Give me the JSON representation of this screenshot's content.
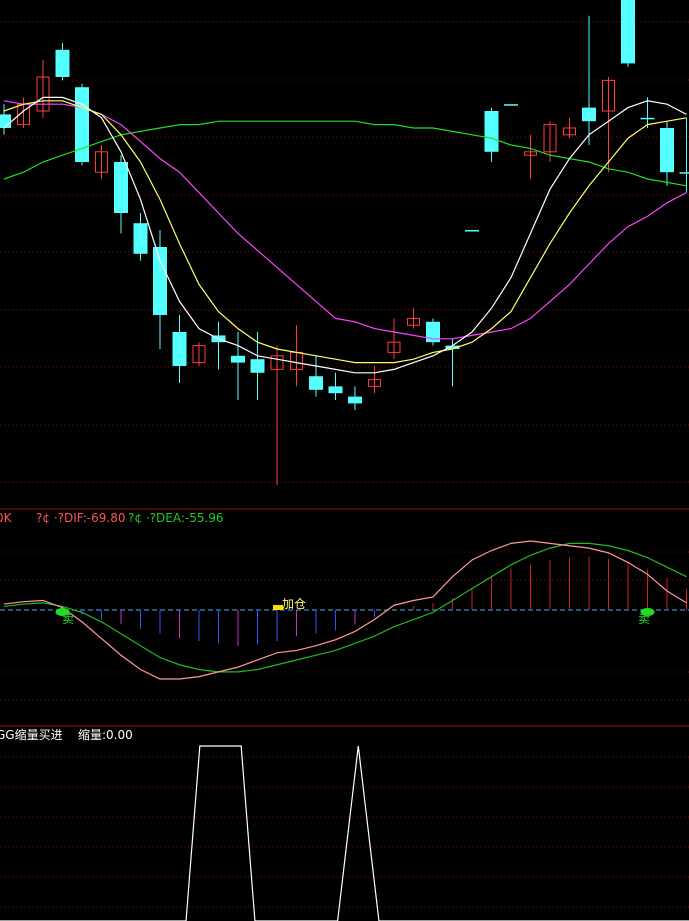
{
  "colors": {
    "background": "#000000",
    "grid": "#8b0000",
    "separator": "#a01010",
    "up_candle": "#ff3b3b",
    "down_candle": "#54ffff",
    "ma_white": "#ffffff",
    "ma_yellow": "#ffff66",
    "ma_magenta": "#ff44ff",
    "ma_green": "#22dd22",
    "dif": "#ff9999",
    "dea": "#22bb22",
    "bar_pos": "#cc2222",
    "bar_neg_blue": "#3355ff",
    "bar_neg_magenta": "#cc33cc",
    "signal_buy": "#22dd22",
    "signal_add": "#ffdd00",
    "dif_label": "#ff5555",
    "dea_label": "#22cc22",
    "suo_line": "#ffffff"
  },
  "macd_panel": {
    "prefix": "0K",
    "dif_label": "?¢ ·?DIF:-69.80",
    "dea_label": "?¢ ·?DEA:-55.96",
    "add_signal": "加仓",
    "sell_signal": "卖"
  },
  "volume_panel": {
    "title": "GG缩量买进",
    "value_label": "缩量:0.00"
  },
  "chart_data": [
    {
      "type": "candlestick",
      "title": "",
      "grid": true,
      "legend": "none",
      "ylim": [
        0,
        100
      ],
      "candles": [
        {
          "o": 59,
          "c": 55,
          "h": 62,
          "l": 53,
          "dir": "down"
        },
        {
          "o": 56,
          "c": 62,
          "h": 64,
          "l": 55,
          "dir": "up"
        },
        {
          "o": 60,
          "c": 70,
          "h": 75,
          "l": 58,
          "dir": "up"
        },
        {
          "o": 70,
          "c": 78,
          "h": 80,
          "l": 69,
          "dir": "down"
        },
        {
          "o": 67,
          "c": 45,
          "h": 68,
          "l": 44,
          "dir": "down"
        },
        {
          "o": 42,
          "c": 48,
          "h": 50,
          "l": 40,
          "dir": "up"
        },
        {
          "o": 45,
          "c": 30,
          "h": 47,
          "l": 24,
          "dir": "down"
        },
        {
          "o": 27,
          "c": 18,
          "h": 30,
          "l": 16,
          "dir": "down"
        },
        {
          "o": 20,
          "c": 0,
          "h": 25,
          "l": -10,
          "dir": "down"
        },
        {
          "o": -5,
          "c": -15,
          "h": 0,
          "l": -20,
          "dir": "down"
        },
        {
          "o": -14,
          "c": -9,
          "h": -8,
          "l": -15,
          "dir": "up"
        },
        {
          "o": -6,
          "c": -8,
          "h": -2,
          "l": -16,
          "dir": "down"
        },
        {
          "o": -12,
          "c": -14,
          "h": -5,
          "l": -25,
          "dir": "down"
        },
        {
          "o": -13,
          "c": -17,
          "h": -5,
          "l": -25,
          "dir": "down"
        },
        {
          "o": -16,
          "c": -12,
          "h": -9,
          "l": -50,
          "dir": "up"
        },
        {
          "o": -16,
          "c": -11,
          "h": -3,
          "l": -21,
          "dir": "up"
        },
        {
          "o": -18,
          "c": -22,
          "h": -12,
          "l": -24,
          "dir": "down"
        },
        {
          "o": -21,
          "c": -23,
          "h": -17,
          "l": -25,
          "dir": "down"
        },
        {
          "o": -24,
          "c": -26,
          "h": -21,
          "l": -28,
          "dir": "down"
        },
        {
          "o": -21,
          "c": -19,
          "h": -15,
          "l": -23,
          "dir": "up"
        },
        {
          "o": -11,
          "c": -8,
          "h": -1,
          "l": -13,
          "dir": "up"
        },
        {
          "o": -3,
          "c": -1,
          "h": 2,
          "l": -4,
          "dir": "up"
        },
        {
          "o": -2,
          "c": -8,
          "h": -1,
          "l": -9,
          "dir": "down"
        },
        {
          "o": -9,
          "c": -10,
          "h": -7,
          "l": -21,
          "dir": "down"
        },
        {
          "o": 25,
          "c": 25,
          "h": 25,
          "l": 25,
          "dir": "down"
        },
        {
          "o": 60,
          "c": 48,
          "h": 61,
          "l": 45,
          "dir": "down"
        },
        {
          "o": 62,
          "c": 62,
          "h": 62,
          "l": 62,
          "dir": "down"
        },
        {
          "o": 47,
          "c": 48,
          "h": 53,
          "l": 40,
          "dir": "up"
        },
        {
          "o": 48,
          "c": 56,
          "h": 57,
          "l": 45,
          "dir": "up"
        },
        {
          "o": 53,
          "c": 55,
          "h": 58,
          "l": 52,
          "dir": "up"
        },
        {
          "o": 57,
          "c": 61,
          "h": 88,
          "l": 50,
          "dir": "down"
        },
        {
          "o": 60,
          "c": 69,
          "h": 70,
          "l": 42,
          "dir": "up"
        },
        {
          "o": 74,
          "c": 115,
          "h": 130,
          "l": 73,
          "dir": "down"
        },
        {
          "o": 58,
          "c": 58,
          "h": 64,
          "l": 55,
          "dir": "down"
        },
        {
          "o": 55,
          "c": 42,
          "h": 57,
          "l": 38,
          "dir": "down"
        },
        {
          "o": 42,
          "c": 42,
          "h": 58,
          "l": 36,
          "dir": "down"
        }
      ],
      "ma_white": [
        55,
        60,
        64,
        64,
        62,
        58,
        48,
        34,
        16,
        4,
        -4,
        -7,
        -9,
        -12,
        -13,
        -14,
        -15,
        -16,
        -17,
        -17,
        -16,
        -14,
        -12,
        -9,
        -5,
        2,
        11,
        24,
        37,
        46,
        53,
        57,
        61,
        63,
        62,
        59
      ],
      "ma_yellow": [
        60,
        62,
        63,
        63,
        61,
        59,
        53,
        45,
        34,
        21,
        9,
        1,
        -4,
        -8,
        -10,
        -11,
        -12,
        -13,
        -14,
        -14,
        -14,
        -13,
        -11,
        -10,
        -8,
        -4,
        1,
        11,
        21,
        30,
        38,
        45,
        52,
        56,
        57,
        58
      ],
      "ma_magenta": [
        63,
        62,
        62,
        62,
        61,
        59,
        56,
        51,
        46,
        42,
        36,
        30,
        24,
        19,
        14,
        9,
        4,
        -1,
        -2,
        -4,
        -5,
        -6,
        -7,
        -7,
        -6,
        -5,
        -4,
        -1,
        4,
        9,
        15,
        21,
        26,
        29,
        33,
        36
      ],
      "ma_green": [
        40,
        42,
        45,
        47,
        49,
        51,
        53,
        54,
        55,
        56,
        56,
        57,
        57,
        57,
        57,
        57,
        57,
        57,
        57,
        56,
        56,
        55,
        55,
        54,
        53,
        52,
        50,
        49,
        47,
        46,
        45,
        43,
        42,
        40,
        39,
        38
      ]
    },
    {
      "type": "bar",
      "title": "",
      "dif_value": -69.8,
      "dea_value": -55.96,
      "macd_bars": [
        0,
        0,
        0,
        0,
        -4,
        -8,
        -12,
        -16,
        -20,
        -24,
        -26,
        -28,
        -30,
        -29,
        -26,
        -22,
        -20,
        -17,
        -12,
        -6,
        1,
        3,
        6,
        10,
        18,
        28,
        35,
        38,
        42,
        44,
        45,
        43,
        40,
        34,
        27,
        18
      ],
      "dif": [
        5,
        7,
        8,
        2,
        -10,
        -24,
        -38,
        -50,
        -58,
        -58,
        -56,
        -52,
        -48,
        -42,
        -36,
        -34,
        -30,
        -25,
        -18,
        -8,
        4,
        8,
        11,
        28,
        42,
        50,
        56,
        58,
        56,
        54,
        52,
        48,
        40,
        30,
        16,
        6
      ],
      "dea": [
        3,
        5,
        6,
        3,
        -2,
        -10,
        -20,
        -30,
        -40,
        -46,
        -50,
        -52,
        -52,
        -50,
        -46,
        -42,
        -38,
        -34,
        -28,
        -22,
        -14,
        -8,
        -2,
        8,
        18,
        28,
        38,
        46,
        52,
        56,
        56,
        54,
        50,
        44,
        36,
        28
      ],
      "signals": [
        {
          "index": 3,
          "kind": "sell"
        },
        {
          "index": 14,
          "kind": "add"
        },
        {
          "index": 33,
          "kind": "sell"
        }
      ]
    },
    {
      "type": "line",
      "title": "",
      "ylim": [
        0,
        1
      ],
      "x": [
        0,
        0.27,
        0.29,
        0.35,
        0.37,
        0.49,
        0.52,
        0.55,
        0.58,
        1
      ],
      "y": [
        0,
        0,
        1,
        1,
        0,
        0,
        1,
        0,
        0,
        0
      ]
    }
  ]
}
